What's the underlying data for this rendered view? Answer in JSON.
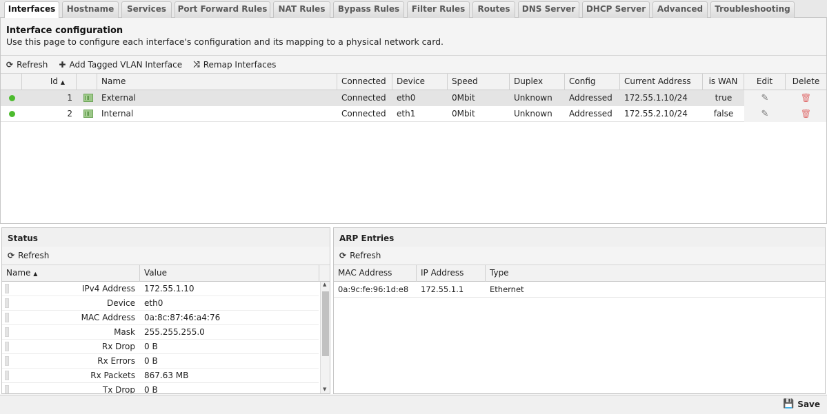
{
  "tabs": [
    {
      "label": "Interfaces",
      "active": true
    },
    {
      "label": "Hostname"
    },
    {
      "label": "Services"
    },
    {
      "label": "Port Forward Rules"
    },
    {
      "label": "NAT Rules"
    },
    {
      "label": "Bypass Rules"
    },
    {
      "label": "Filter Rules"
    },
    {
      "label": "Routes"
    },
    {
      "label": "DNS Server"
    },
    {
      "label": "DHCP Server"
    },
    {
      "label": "Advanced"
    },
    {
      "label": "Troubleshooting"
    }
  ],
  "page": {
    "title": "Interface configuration",
    "description": "Use this page to configure each interface's configuration and its mapping to a physical network card."
  },
  "toolbar": {
    "refresh": "Refresh",
    "add_vlan": "Add Tagged VLAN Interface",
    "remap": "Remap Interfaces"
  },
  "iface_grid": {
    "columns": {
      "id": "Id",
      "name": "Name",
      "connected": "Connected",
      "device": "Device",
      "speed": "Speed",
      "duplex": "Duplex",
      "config": "Config",
      "address": "Current Address",
      "is_wan": "is WAN",
      "edit": "Edit",
      "delete": "Delete"
    },
    "rows": [
      {
        "id": "1",
        "name": "External",
        "connected": "Connected",
        "device": "eth0",
        "speed": "0Mbit",
        "duplex": "Unknown",
        "config": "Addressed",
        "address": "172.55.1.10/24",
        "is_wan": "true"
      },
      {
        "id": "2",
        "name": "Internal",
        "connected": "Connected",
        "device": "eth1",
        "speed": "0Mbit",
        "duplex": "Unknown",
        "config": "Addressed",
        "address": "172.55.2.10/24",
        "is_wan": "false"
      }
    ]
  },
  "status": {
    "title": "Status",
    "refresh": "Refresh",
    "col_name": "Name",
    "col_value": "Value",
    "rows": [
      {
        "k": "IPv4 Address",
        "v": "172.55.1.10"
      },
      {
        "k": "Device",
        "v": "eth0"
      },
      {
        "k": "MAC Address",
        "v": "0a:8c:87:46:a4:76"
      },
      {
        "k": "Mask",
        "v": "255.255.255.0"
      },
      {
        "k": "Rx Drop",
        "v": "0 B"
      },
      {
        "k": "Rx Errors",
        "v": "0 B"
      },
      {
        "k": "Rx Packets",
        "v": "867.63 MB"
      },
      {
        "k": "Tx Drop",
        "v": "0 B"
      }
    ]
  },
  "arp": {
    "title": "ARP Entries",
    "refresh": "Refresh",
    "col_mac": "MAC Address",
    "col_ip": "IP Address",
    "col_type": "Type",
    "rows": [
      {
        "mac": "0a:9c:fe:96:1d:e8",
        "ip": "172.55.1.1",
        "type": "Ethernet"
      }
    ]
  },
  "footer": {
    "save": "Save"
  },
  "icons": {
    "refresh": "refresh-icon",
    "add": "plus-icon",
    "remap": "shuffle-icon",
    "edit": "pencil-icon",
    "delete": "trash-icon",
    "save": "floppy-icon",
    "status_dot_color": "#4cbb2e"
  }
}
